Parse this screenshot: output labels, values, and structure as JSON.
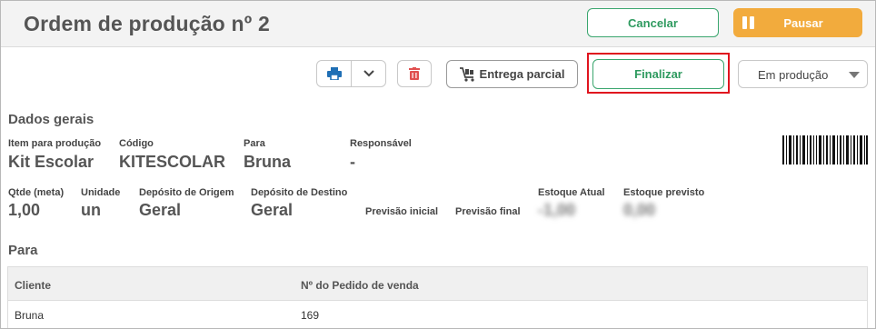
{
  "header": {
    "title": "Ordem de produção nº 2",
    "cancel_label": "Cancelar",
    "pause_label": "Pausar"
  },
  "toolbar": {
    "partial_delivery_label": "Entrega parcial",
    "finish_label": "Finalizar",
    "status_value": "Em produção"
  },
  "general": {
    "section_title": "Dados gerais",
    "item_label": "Item para produção",
    "item_value": "Kit Escolar",
    "code_label": "Código",
    "code_value": "KITESCOLAR",
    "for_label": "Para",
    "for_value": "Bruna",
    "responsible_label": "Responsável",
    "responsible_value": "-",
    "qty_label": "Qtde (meta)",
    "qty_value": "1,00",
    "unit_label": "Unidade",
    "unit_value": "un",
    "origin_label": "Depósito de Origem",
    "origin_value": "Geral",
    "dest_label": "Depósito de Destino",
    "dest_value": "Geral",
    "initial_forecast_label": "Previsão inicial",
    "final_forecast_label": "Previsão final",
    "current_stock_label": "Estoque Atual",
    "current_stock_value": "-1,00",
    "forecast_stock_label": "Estoque previsto",
    "forecast_stock_value": "0,00"
  },
  "recipients": {
    "section_title": "Para",
    "columns": [
      "Cliente",
      "Nº do Pedido de venda"
    ],
    "rows": [
      [
        "Bruna",
        "169"
      ]
    ]
  },
  "colors": {
    "accent_green": "#2e9a5f",
    "pause_orange": "#f2ab3d",
    "delete_red": "#e05050",
    "print_blue": "#1f6fb5",
    "highlight_red": "#e0141e"
  },
  "icons": [
    "pause-icon",
    "printer-icon",
    "chevron-down-icon",
    "trash-icon",
    "cart-icon",
    "caret-down-icon",
    "barcode-icon"
  ]
}
